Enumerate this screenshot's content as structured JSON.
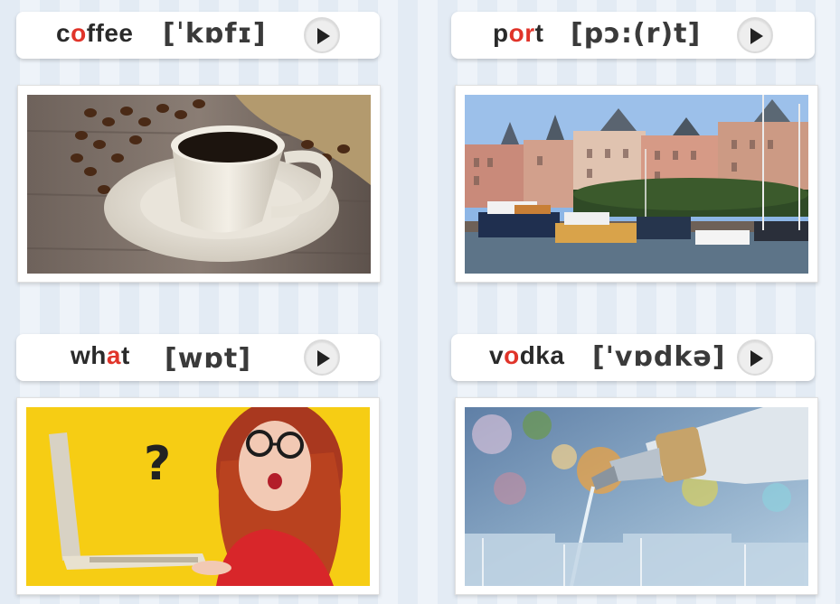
{
  "cards": [
    {
      "word_parts": [
        "c",
        "o",
        "ffee"
      ],
      "ipa": "[ˈkɒfɪ]",
      "image": "coffee-cup-photo",
      "play_icon": "play-icon"
    },
    {
      "word_parts": [
        "p",
        "or",
        "t"
      ],
      "ipa": "[pɔ:(r)t]",
      "image": "harbor-port-photo",
      "play_icon": "play-icon"
    },
    {
      "word_parts": [
        "wh",
        "a",
        "t"
      ],
      "ipa": "[wɒt]",
      "image": "surprised-woman-laptop-photo",
      "play_icon": "play-icon"
    },
    {
      "word_parts": [
        "v",
        "o",
        "dka"
      ],
      "ipa": "['vɒdkə]",
      "image": "vodka-pouring-photo",
      "play_icon": "play-icon"
    }
  ],
  "colors": {
    "highlight": "#e0342a",
    "word": "#2a2a2a",
    "background_stripe_a": "#e3ebf4",
    "background_stripe_b": "#eef3f9"
  }
}
